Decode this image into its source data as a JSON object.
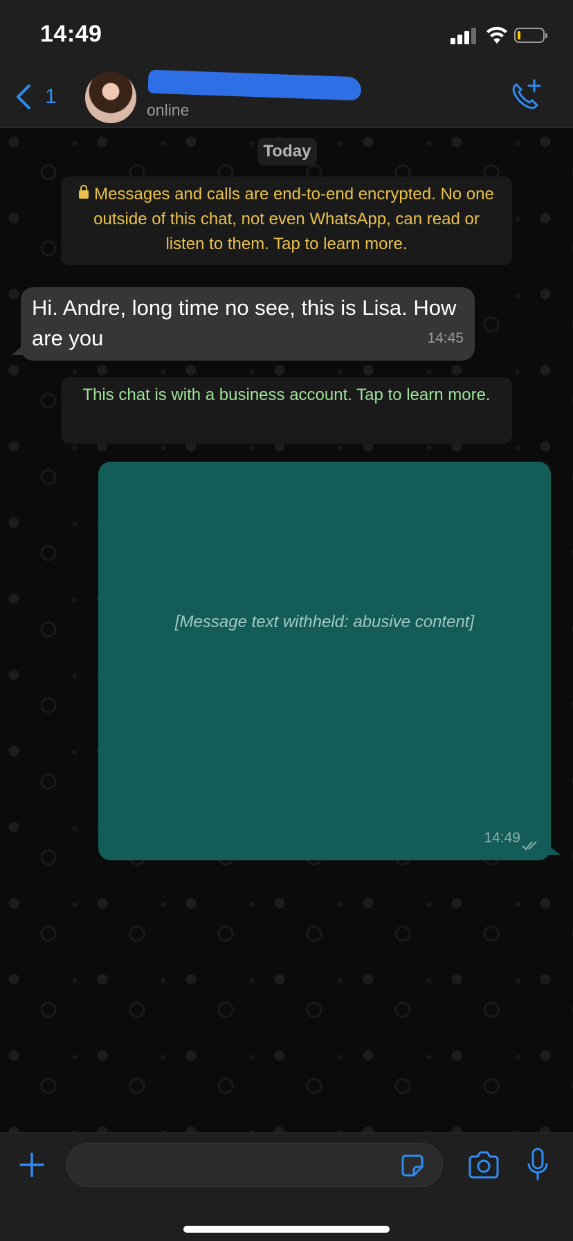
{
  "status_bar": {
    "time": "14:49"
  },
  "header": {
    "back_count": "1",
    "contact_status": "online",
    "icons": {
      "back": "chevron-left-icon",
      "call": "add-call-icon"
    }
  },
  "chat": {
    "date_label": "Today",
    "encryption_notice": "Messages and calls are end-to-end encrypted. No one outside of this chat, not even WhatsApp, can read or listen to them. Tap to learn more.",
    "business_notice": "This chat is with a business account. Tap to learn more.",
    "messages": [
      {
        "direction": "incoming",
        "text": "Hi. Andre, long time no see, this is Lisa. How are you",
        "time": "14:45"
      },
      {
        "direction": "outgoing",
        "text": "[Message text withheld: abusive content]",
        "time": "14:49",
        "status": "read"
      }
    ]
  },
  "composer": {
    "input_value": "",
    "icons": {
      "add": "plus-icon",
      "sticker": "sticker-icon",
      "camera": "camera-icon",
      "mic": "microphone-icon"
    }
  },
  "colors": {
    "accent": "#2f8cf4",
    "outgoing_bubble": "#135c58",
    "incoming_bubble": "#363636",
    "encryption_text": "#e9c14c",
    "business_text": "#9fe39a"
  }
}
